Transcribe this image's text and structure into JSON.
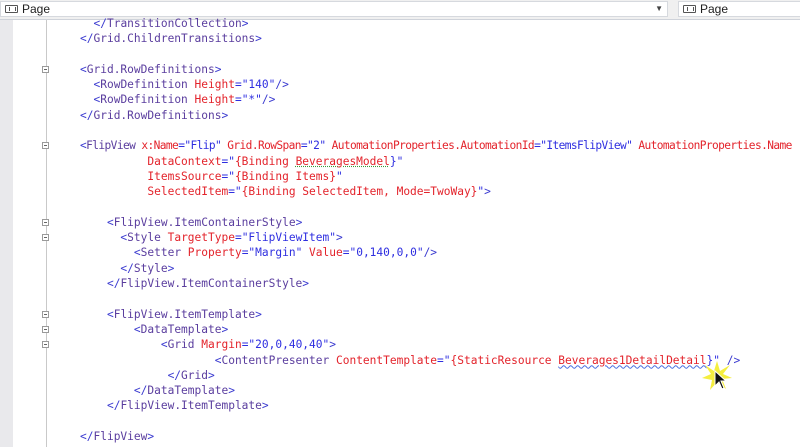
{
  "toolbar": {
    "left_combo": {
      "label": "Page",
      "icon": "xaml-element-icon"
    },
    "right_combo": {
      "label": "Page",
      "icon": "xaml-element-icon"
    }
  },
  "editor": {
    "lines": [
      {
        "indent": 2,
        "fold": false,
        "segs": [
          [
            "</",
            "d"
          ],
          [
            "TransitionCollection",
            "e"
          ],
          [
            ">",
            "d"
          ]
        ]
      },
      {
        "indent": 0,
        "fold": false,
        "segs": [
          [
            "</",
            "d"
          ],
          [
            "Grid.ChildrenTransitions",
            "e"
          ],
          [
            ">",
            "d"
          ]
        ]
      },
      {
        "indent": 0,
        "fold": false,
        "segs": []
      },
      {
        "indent": 0,
        "fold": true,
        "segs": [
          [
            "<",
            "d"
          ],
          [
            "Grid.RowDefinitions",
            "e"
          ],
          [
            ">",
            "d"
          ]
        ]
      },
      {
        "indent": 2,
        "fold": false,
        "segs": [
          [
            "<",
            "d"
          ],
          [
            "RowDefinition",
            "e"
          ],
          [
            " Height",
            "a"
          ],
          [
            "=\"140\"",
            "v"
          ],
          [
            "/>",
            "d"
          ]
        ]
      },
      {
        "indent": 2,
        "fold": false,
        "segs": [
          [
            "<",
            "d"
          ],
          [
            "RowDefinition",
            "e"
          ],
          [
            " Height",
            "a"
          ],
          [
            "=\"*\"",
            "v"
          ],
          [
            "/>",
            "d"
          ]
        ]
      },
      {
        "indent": 0,
        "fold": false,
        "segs": [
          [
            "</",
            "d"
          ],
          [
            "Grid.RowDefinitions",
            "e"
          ],
          [
            ">",
            "d"
          ]
        ]
      },
      {
        "indent": 0,
        "fold": false,
        "segs": []
      },
      {
        "indent": 0,
        "fold": true,
        "segs": [
          [
            "<",
            "d"
          ],
          [
            "FlipView",
            "e"
          ],
          [
            " x:Name",
            "a"
          ],
          [
            "=\"Flip\"",
            "v"
          ],
          [
            " Grid.RowSpan",
            "a"
          ],
          [
            "=\"2\"",
            "v"
          ],
          [
            " AutomationProperties.AutomationId",
            "a"
          ],
          [
            "=\"ItemsFlipView\"",
            "v"
          ],
          [
            " AutomationProperties.Name",
            "a"
          ]
        ]
      },
      {
        "indent": 10,
        "fold": false,
        "segs": [
          [
            "DataContext",
            "a"
          ],
          [
            "=\"",
            "v"
          ],
          [
            "{Binding ",
            "b"
          ],
          [
            "BeveragesModel",
            "b dots"
          ],
          [
            "}\"",
            "v"
          ]
        ]
      },
      {
        "indent": 10,
        "fold": false,
        "segs": [
          [
            "ItemsSource",
            "a"
          ],
          [
            "=\"",
            "v"
          ],
          [
            "{Binding Items}",
            "b"
          ],
          [
            "\"",
            "v"
          ]
        ]
      },
      {
        "indent": 10,
        "fold": false,
        "segs": [
          [
            "SelectedItem",
            "a"
          ],
          [
            "=\"",
            "v"
          ],
          [
            "{Binding SelectedItem, Mode=TwoWay}",
            "b"
          ],
          [
            "\"",
            "v"
          ],
          [
            ">",
            "d"
          ]
        ]
      },
      {
        "indent": 0,
        "fold": false,
        "segs": []
      },
      {
        "indent": 4,
        "fold": true,
        "segs": [
          [
            "<",
            "d"
          ],
          [
            "FlipView.ItemContainerStyle",
            "e"
          ],
          [
            ">",
            "d"
          ]
        ]
      },
      {
        "indent": 6,
        "fold": true,
        "segs": [
          [
            "<",
            "d"
          ],
          [
            "Style",
            "e"
          ],
          [
            " TargetType",
            "a"
          ],
          [
            "=\"FlipViewItem\"",
            "v"
          ],
          [
            ">",
            "d"
          ]
        ]
      },
      {
        "indent": 8,
        "fold": false,
        "segs": [
          [
            "<",
            "d"
          ],
          [
            "Setter",
            "e"
          ],
          [
            " Property",
            "a"
          ],
          [
            "=\"Margin\"",
            "v"
          ],
          [
            " Value",
            "a"
          ],
          [
            "=\"0,140,0,0\"",
            "v"
          ],
          [
            "/>",
            "d"
          ]
        ]
      },
      {
        "indent": 6,
        "fold": false,
        "segs": [
          [
            "</",
            "d"
          ],
          [
            "Style",
            "e"
          ],
          [
            ">",
            "d"
          ]
        ]
      },
      {
        "indent": 4,
        "fold": false,
        "segs": [
          [
            "</",
            "d"
          ],
          [
            "FlipView.ItemContainerStyle",
            "e"
          ],
          [
            ">",
            "d"
          ]
        ]
      },
      {
        "indent": 0,
        "fold": false,
        "segs": []
      },
      {
        "indent": 4,
        "fold": true,
        "segs": [
          [
            "<",
            "d"
          ],
          [
            "FlipView.ItemTemplate",
            "e"
          ],
          [
            ">",
            "d"
          ]
        ]
      },
      {
        "indent": 8,
        "fold": true,
        "segs": [
          [
            "<",
            "d"
          ],
          [
            "DataTemplate",
            "e"
          ],
          [
            ">",
            "d"
          ]
        ]
      },
      {
        "indent": 12,
        "fold": true,
        "segs": [
          [
            "<",
            "d"
          ],
          [
            "Grid",
            "e"
          ],
          [
            " Margin",
            "a"
          ],
          [
            "=\"20,0,40,40\"",
            "v"
          ],
          [
            ">",
            "d"
          ]
        ]
      },
      {
        "indent": 20,
        "fold": false,
        "segs": [
          [
            "<",
            "d"
          ],
          [
            "ContentPresenter",
            "e"
          ],
          [
            " ContentTemplate",
            "a"
          ],
          [
            "=\"",
            "v"
          ],
          [
            "{StaticResource ",
            "b"
          ],
          [
            "Beverages1DetailDetail",
            "b squig"
          ],
          [
            "}\"",
            "v"
          ],
          [
            " />",
            "d"
          ]
        ]
      },
      {
        "indent": 13,
        "fold": false,
        "segs": [
          [
            "</",
            "d"
          ],
          [
            "Grid",
            "e"
          ],
          [
            ">",
            "d"
          ]
        ]
      },
      {
        "indent": 8,
        "fold": false,
        "segs": [
          [
            "</",
            "d"
          ],
          [
            "DataTemplate",
            "e"
          ],
          [
            ">",
            "d"
          ]
        ]
      },
      {
        "indent": 4,
        "fold": false,
        "segs": [
          [
            "</",
            "d"
          ],
          [
            "FlipView.ItemTemplate",
            "e"
          ],
          [
            ">",
            "d"
          ]
        ]
      },
      {
        "indent": 0,
        "fold": false,
        "segs": []
      },
      {
        "indent": 0,
        "fold": false,
        "segs": [
          [
            "</",
            "d"
          ],
          [
            "FlipView",
            "e"
          ],
          [
            ">",
            "d"
          ]
        ]
      }
    ]
  }
}
